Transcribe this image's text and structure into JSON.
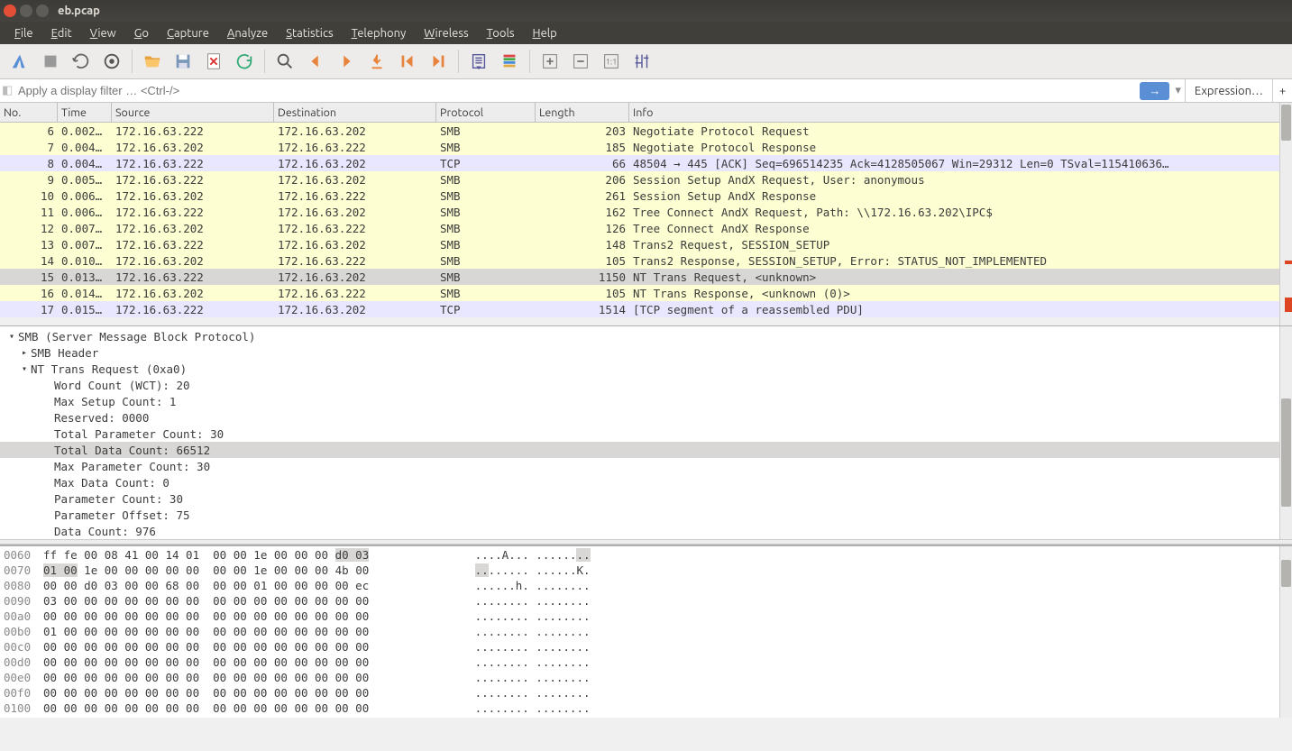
{
  "window": {
    "title": "eb.pcap"
  },
  "menu": {
    "items": [
      "File",
      "Edit",
      "View",
      "Go",
      "Capture",
      "Analyze",
      "Statistics",
      "Telephony",
      "Wireless",
      "Tools",
      "Help"
    ]
  },
  "filter": {
    "placeholder": "Apply a display filter … <Ctrl-/>",
    "go": "→",
    "expression": "Expression…",
    "plus": "+"
  },
  "columns": {
    "no": "No.",
    "time": "Time",
    "source": "Source",
    "destination": "Destination",
    "protocol": "Protocol",
    "length": "Length",
    "info": "Info"
  },
  "packets": [
    {
      "no": "6",
      "time": "0.002…",
      "src": "172.16.63.222",
      "dst": "172.16.63.202",
      "proto": "SMB",
      "len": "203",
      "info": "Negotiate Protocol Request",
      "cls": "smb"
    },
    {
      "no": "7",
      "time": "0.004…",
      "src": "172.16.63.202",
      "dst": "172.16.63.222",
      "proto": "SMB",
      "len": "185",
      "info": "Negotiate Protocol Response",
      "cls": "smb"
    },
    {
      "no": "8",
      "time": "0.004…",
      "src": "172.16.63.222",
      "dst": "172.16.63.202",
      "proto": "TCP",
      "len": "66",
      "info": "48504 → 445 [ACK] Seq=696514235 Ack=4128505067 Win=29312 Len=0 TSval=115410636…",
      "cls": "tcp"
    },
    {
      "no": "9",
      "time": "0.005…",
      "src": "172.16.63.222",
      "dst": "172.16.63.202",
      "proto": "SMB",
      "len": "206",
      "info": "Session Setup AndX Request, User: anonymous",
      "cls": "smb"
    },
    {
      "no": "10",
      "time": "0.006…",
      "src": "172.16.63.202",
      "dst": "172.16.63.222",
      "proto": "SMB",
      "len": "261",
      "info": "Session Setup AndX Response",
      "cls": "smb"
    },
    {
      "no": "11",
      "time": "0.006…",
      "src": "172.16.63.222",
      "dst": "172.16.63.202",
      "proto": "SMB",
      "len": "162",
      "info": "Tree Connect AndX Request, Path: \\\\172.16.63.202\\IPC$",
      "cls": "smb"
    },
    {
      "no": "12",
      "time": "0.007…",
      "src": "172.16.63.202",
      "dst": "172.16.63.222",
      "proto": "SMB",
      "len": "126",
      "info": "Tree Connect AndX Response",
      "cls": "smb"
    },
    {
      "no": "13",
      "time": "0.007…",
      "src": "172.16.63.222",
      "dst": "172.16.63.202",
      "proto": "SMB",
      "len": "148",
      "info": "Trans2 Request, SESSION_SETUP",
      "cls": "smb"
    },
    {
      "no": "14",
      "time": "0.010…",
      "src": "172.16.63.202",
      "dst": "172.16.63.222",
      "proto": "SMB",
      "len": "105",
      "info": "Trans2 Response, SESSION_SETUP, Error: STATUS_NOT_IMPLEMENTED",
      "cls": "smb"
    },
    {
      "no": "15",
      "time": "0.013…",
      "src": "172.16.63.222",
      "dst": "172.16.63.202",
      "proto": "SMB",
      "len": "1150",
      "info": "NT Trans Request, <unknown>",
      "cls": "sel"
    },
    {
      "no": "16",
      "time": "0.014…",
      "src": "172.16.63.202",
      "dst": "172.16.63.222",
      "proto": "SMB",
      "len": "105",
      "info": "NT Trans Response, <unknown (0)>",
      "cls": "smb"
    },
    {
      "no": "17",
      "time": "0.015…",
      "src": "172.16.63.222",
      "dst": "172.16.63.202",
      "proto": "TCP",
      "len": "1514",
      "info": "[TCP segment of a reassembled PDU]",
      "cls": "tcp"
    }
  ],
  "tree": [
    {
      "lvl": 0,
      "tri": "▾",
      "txt": "SMB (Server Message Block Protocol)",
      "hl": false
    },
    {
      "lvl": 1,
      "tri": "▸",
      "txt": "SMB Header",
      "hl": false
    },
    {
      "lvl": 1,
      "tri": "▾",
      "txt": "NT Trans Request (0xa0)",
      "hl": false
    },
    {
      "lvl": 3,
      "tri": "",
      "txt": "Word Count (WCT): 20",
      "hl": false
    },
    {
      "lvl": 3,
      "tri": "",
      "txt": "Max Setup Count: 1",
      "hl": false
    },
    {
      "lvl": 3,
      "tri": "",
      "txt": "Reserved: 0000",
      "hl": false
    },
    {
      "lvl": 3,
      "tri": "",
      "txt": "Total Parameter Count: 30",
      "hl": false
    },
    {
      "lvl": 3,
      "tri": "",
      "txt": "Total Data Count: 66512",
      "hl": true
    },
    {
      "lvl": 3,
      "tri": "",
      "txt": "Max Parameter Count: 30",
      "hl": false
    },
    {
      "lvl": 3,
      "tri": "",
      "txt": "Max Data Count: 0",
      "hl": false
    },
    {
      "lvl": 3,
      "tri": "",
      "txt": "Parameter Count: 30",
      "hl": false
    },
    {
      "lvl": 3,
      "tri": "",
      "txt": "Parameter Offset: 75",
      "hl": false
    },
    {
      "lvl": 3,
      "tri": "",
      "txt": "Data Count: 976",
      "hl": false
    }
  ],
  "hex": [
    {
      "off": "0060",
      "hex": "ff fe 00 08 41 00 14 01  00 00 1e 00 00 00 ",
      "hexsel": "d0 03",
      "asc": "....A... ......",
      "ascsel": ".."
    },
    {
      "off": "0070",
      "hex": "",
      "hexsel": "01 00",
      "hex2": " 1e 00 00 00 00 00  00 00 1e 00 00 00 4b 00",
      "asc": "",
      "ascsel": "..",
      "asc2": "...... ......K."
    },
    {
      "off": "0080",
      "hex": "00 00 d0 03 00 00 68 00  00 00 01 00 00 00 00 ec",
      "asc": "......h. ........"
    },
    {
      "off": "0090",
      "hex": "03 00 00 00 00 00 00 00  00 00 00 00 00 00 00 00",
      "asc": "........ ........"
    },
    {
      "off": "00a0",
      "hex": "00 00 00 00 00 00 00 00  00 00 00 00 00 00 00 00",
      "asc": "........ ........"
    },
    {
      "off": "00b0",
      "hex": "01 00 00 00 00 00 00 00  00 00 00 00 00 00 00 00",
      "asc": "........ ........"
    },
    {
      "off": "00c0",
      "hex": "00 00 00 00 00 00 00 00  00 00 00 00 00 00 00 00",
      "asc": "........ ........"
    },
    {
      "off": "00d0",
      "hex": "00 00 00 00 00 00 00 00  00 00 00 00 00 00 00 00",
      "asc": "........ ........"
    },
    {
      "off": "00e0",
      "hex": "00 00 00 00 00 00 00 00  00 00 00 00 00 00 00 00",
      "asc": "........ ........"
    },
    {
      "off": "00f0",
      "hex": "00 00 00 00 00 00 00 00  00 00 00 00 00 00 00 00",
      "asc": "........ ........"
    },
    {
      "off": "0100",
      "hex": "00 00 00 00 00 00 00 00  00 00 00 00 00 00 00 00",
      "asc": "........ ........"
    }
  ],
  "toolbar_icons": [
    "shark-fin-icon",
    "stop-icon",
    "restart-icon",
    "options-icon",
    "open-icon",
    "save-icon",
    "close-file-icon",
    "reload-icon",
    "find-icon",
    "prev-icon",
    "next-icon",
    "jump-icon",
    "first-icon",
    "last-icon",
    "autoscroll-icon",
    "colorize-icon",
    "zoom-in-icon",
    "zoom-out-icon",
    "zoom-reset-icon",
    "resize-columns-icon"
  ]
}
